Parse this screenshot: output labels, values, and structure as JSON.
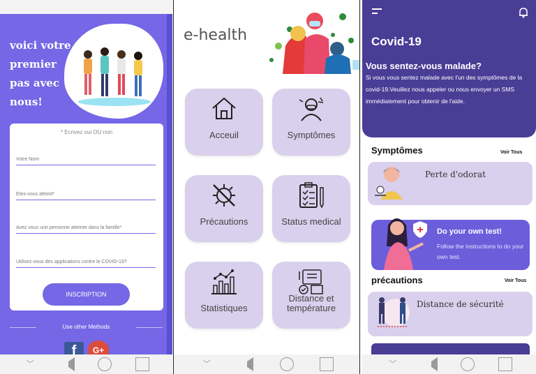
{
  "screen1": {
    "title": "voici votre premier pas avec nous!",
    "form_hint": "* Ecrivez oui OU non",
    "fields": [
      {
        "placeholder": "Votre Nom"
      },
      {
        "placeholder": "Etes-vous atteint*"
      },
      {
        "placeholder": "Avez vous une personne atteinte dans la famille*"
      },
      {
        "placeholder": "Utilisez-vous des applications contre le COVID-19?"
      }
    ],
    "submit_label": "INSCRIPTION",
    "other_methods": "Use other Methods",
    "facebook_label": "f",
    "google_label": "G+"
  },
  "screen2": {
    "app_title": "e-health",
    "tiles": [
      {
        "label": "Acceuil",
        "icon": "house-icon"
      },
      {
        "label": "Symptômes",
        "icon": "sick-person-icon"
      },
      {
        "label": "Précautions",
        "icon": "no-virus-icon"
      },
      {
        "label": "Status medical",
        "icon": "clipboard-icon"
      },
      {
        "label": "Statistiques",
        "icon": "bar-chart-icon"
      },
      {
        "label": "Distance et température",
        "icon": "distance-temp-icon"
      }
    ]
  },
  "screen3": {
    "title": "Covid-19",
    "question": "Vous sentez-vous malade?",
    "description": "Si vous vous sentez malade avec l'un des symptômes de la covid-19.Veuillez  nous appeler ou nous envoyer un SMS immédiatement pour obtenir de l'aide.",
    "symptoms_heading": "Symptômes",
    "see_all": "Voir Tous",
    "symptom_card": "Perte d'odorat",
    "test_title": "Do your own test!",
    "test_sub": "Follow the instructions to do your own test.",
    "precautions_heading": "précautions",
    "precaution_card": "Distance de sécurité"
  },
  "colors": {
    "primary": "#7567e6",
    "dark_purple": "#4a3d96",
    "tile": "#d8d0ec"
  }
}
